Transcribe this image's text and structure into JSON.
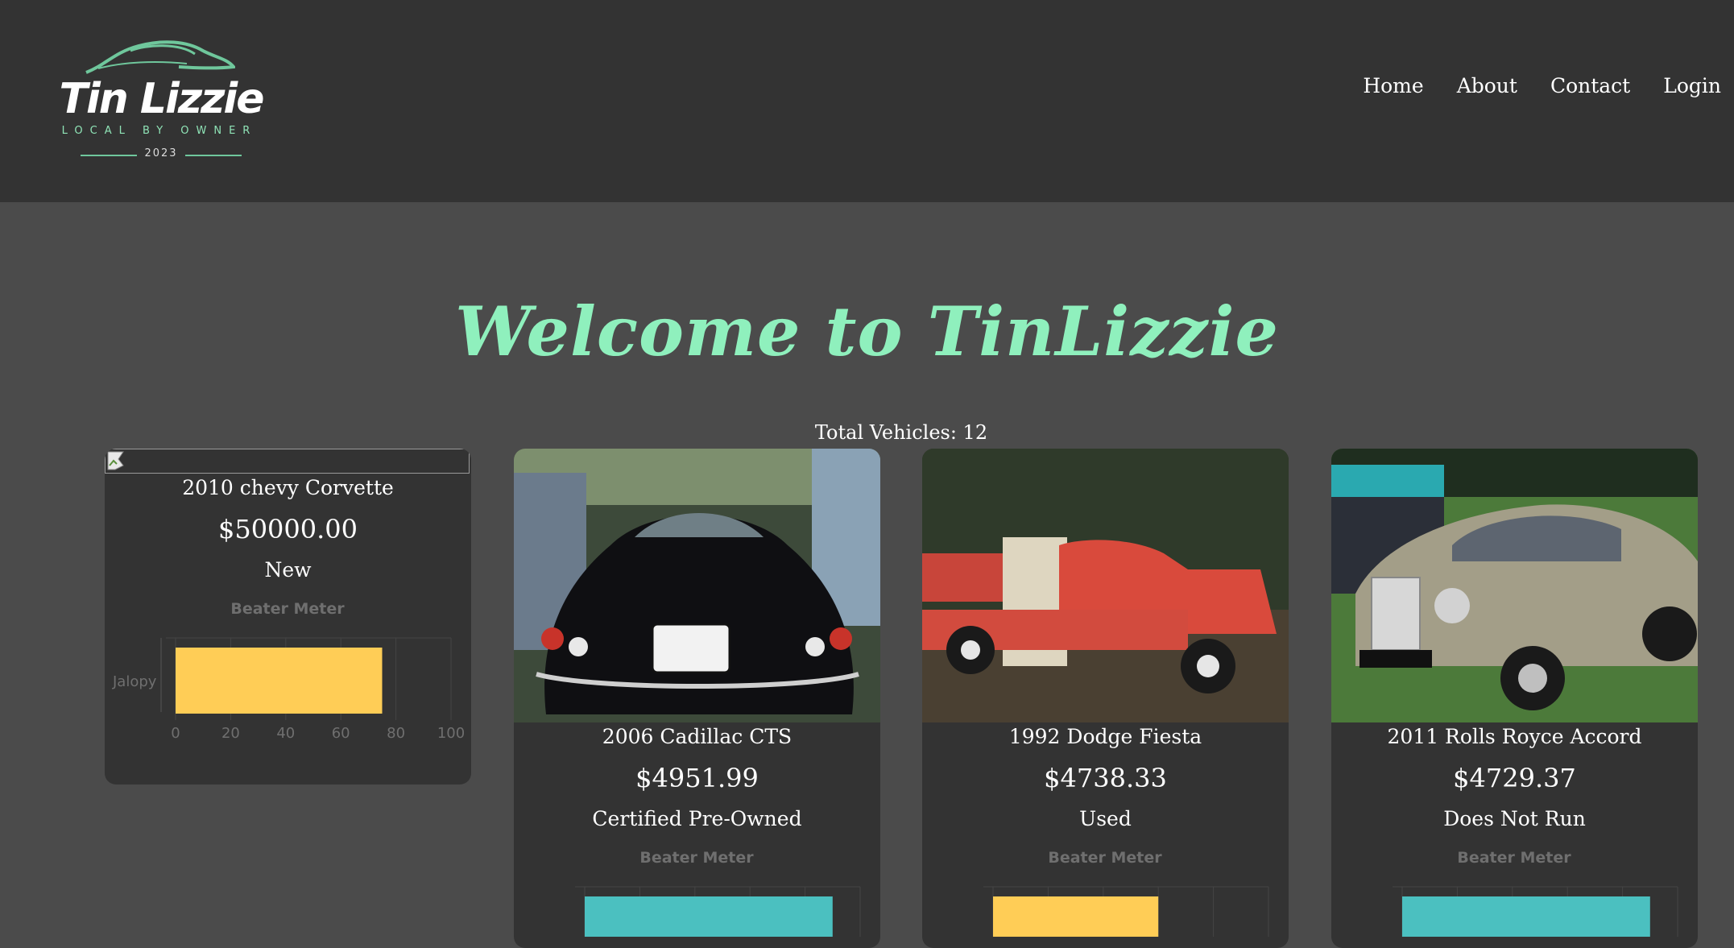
{
  "header": {
    "logo": {
      "title": "Tin Lizzie",
      "tagline": "LOCAL BY OWNER",
      "year": "2023"
    },
    "nav": [
      "Home",
      "About",
      "Contact",
      "Login"
    ]
  },
  "hero": {
    "title": "Welcome to TinLizzie"
  },
  "inventory": {
    "total_label": "Total Vehicles: 12"
  },
  "colors": {
    "accent": "#8ff0bd",
    "header_bg": "#333333",
    "page_bg": "#4b4b4b",
    "bar_yellow": "#ffcd56",
    "bar_teal": "#4bc0c0"
  },
  "cards": [
    {
      "name": "2010 chevy Corvette",
      "price": "$50000.00",
      "condition": "New",
      "image": "broken-image-icon",
      "meter": {
        "title": "Beater Meter",
        "label": "Jalopy",
        "value": 75,
        "ticks": [
          "0",
          "20",
          "40",
          "60",
          "80",
          "100"
        ],
        "color": "#ffcd56"
      }
    },
    {
      "name": "2006 Cadillac CTS",
      "price": "$4951.99",
      "condition": "Certified Pre-Owned",
      "image": "black-classic-car-rear-photo",
      "meter": {
        "title": "Beater Meter",
        "value": 90,
        "color": "#4bc0c0"
      }
    },
    {
      "name": "1992 Dodge Fiesta",
      "price": "$4738.33",
      "condition": "Used",
      "image": "red-utility-truck-photo",
      "meter": {
        "title": "Beater Meter",
        "value": 60,
        "color": "#ffcd56"
      }
    },
    {
      "name": "2011 Rolls Royce Accord",
      "price": "$4729.37",
      "condition": "Does Not Run",
      "image": "silver-rolls-royce-photo",
      "meter": {
        "title": "Beater Meter",
        "value": 90,
        "color": "#4bc0c0"
      }
    }
  ]
}
